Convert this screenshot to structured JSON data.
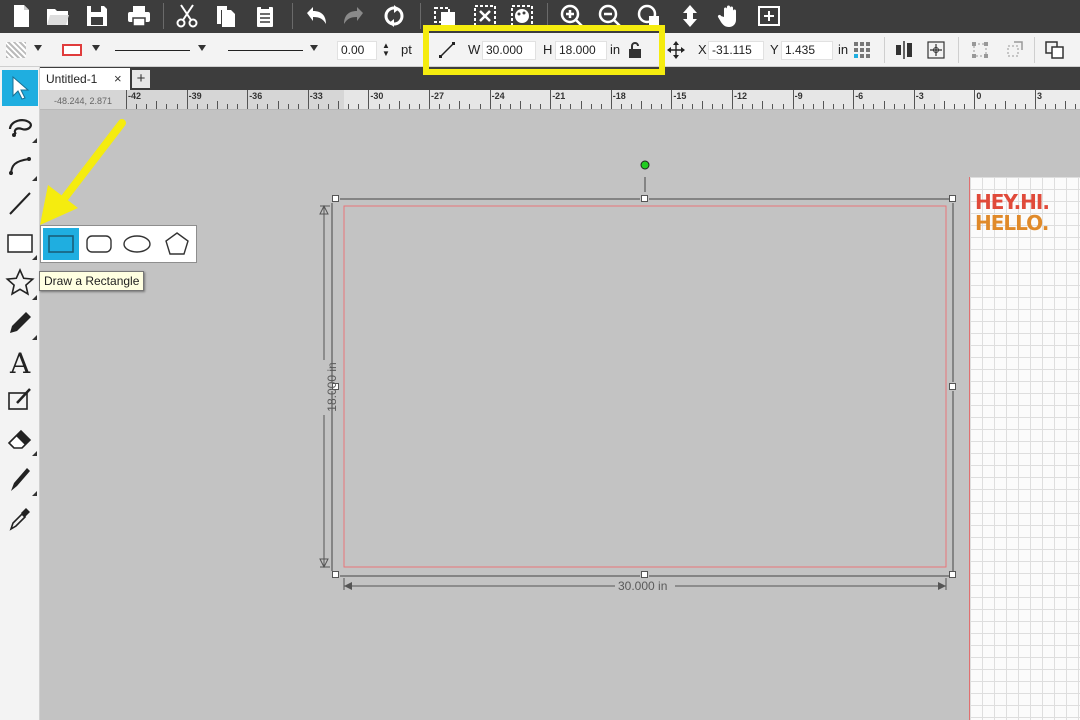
{
  "toolbar": {
    "icons": [
      "new-document-icon",
      "open-folder-icon",
      "save-icon",
      "print-icon",
      "cut-icon",
      "copy-icon",
      "paste-icon",
      "undo-icon",
      "redo-icon",
      "replicate-icon",
      "group-icon",
      "ungroup-icon",
      "fill-palette-icon",
      "zoom-in-icon",
      "zoom-out-icon",
      "zoom-selection-icon",
      "pan-icon",
      "hand-icon",
      "fit-page-icon"
    ]
  },
  "props": {
    "line_width_value": "0.00",
    "line_width_unit": "pt",
    "w_label": "W",
    "w_value": "30.000",
    "h_label": "H",
    "h_value": "18.000",
    "size_unit": "in",
    "x_label": "X",
    "x_value": "-31.115",
    "y_label": "Y",
    "y_value": "1.435",
    "pos_unit": "in",
    "line_color": "#e03c3c"
  },
  "tabs": {
    "doc_name": "Untitled-1",
    "close": "×",
    "add": "+"
  },
  "ruler": {
    "coord": "-48.244, 2.871",
    "labels": [
      "-42",
      "-39",
      "-36",
      "-33",
      "-30",
      "-27",
      "-24",
      "-21",
      "-18",
      "-15",
      "-12",
      "-9",
      "-6",
      "-3",
      "0",
      "3"
    ]
  },
  "canvas": {
    "width_dim": "30.000 in",
    "height_dim": "18.000 in",
    "shape_color": "#e8757a",
    "rotate_handle_color": "#22cc22"
  },
  "flyout": {
    "shapes": [
      "rectangle-shape-icon",
      "rounded-rectangle-icon",
      "ellipse-icon",
      "polygon-icon"
    ],
    "tooltip": "Draw a Rectangle"
  },
  "logo": {
    "line1": "HEY.HI.",
    "line2": "HELLO."
  },
  "accent": "#1faee0",
  "highlight_color": "#f5ec0f"
}
